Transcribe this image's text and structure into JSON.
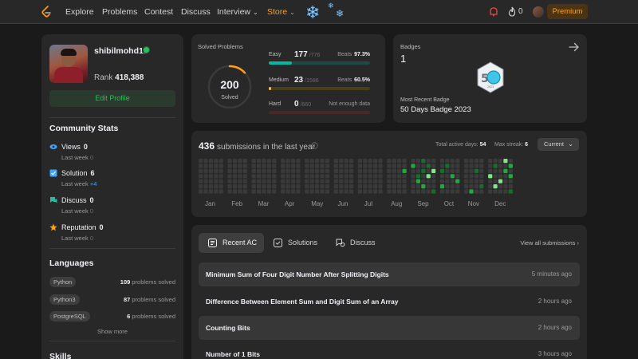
{
  "nav": {
    "links": [
      "Explore",
      "Problems",
      "Contest",
      "Discuss"
    ],
    "interview": "Interview",
    "store": "Store",
    "fire_count": "0",
    "premium": "Premium"
  },
  "profile": {
    "username": "shibilmohd13",
    "rank_label": "Rank",
    "rank_value": "418,388",
    "edit_button": "Edit Profile"
  },
  "community": {
    "title": "Community Stats",
    "stats": [
      {
        "label": "Views",
        "value": "0",
        "sub_label": "Last week",
        "sub_value": "0",
        "icon": "eye-icon"
      },
      {
        "label": "Solution",
        "value": "6",
        "sub_label": "Last week",
        "sub_value": "+4",
        "icon": "solution-icon"
      },
      {
        "label": "Discuss",
        "value": "0",
        "sub_label": "Last week",
        "sub_value": "0",
        "icon": "discuss-icon"
      },
      {
        "label": "Reputation",
        "value": "0",
        "sub_label": "Last week",
        "sub_value": "0",
        "icon": "star-icon"
      }
    ]
  },
  "languages": {
    "title": "Languages",
    "items": [
      {
        "name": "Python",
        "count": "109",
        "suffix": "problems solved"
      },
      {
        "name": "Python3",
        "count": "87",
        "suffix": "problems solved"
      },
      {
        "name": "PostgreSQL",
        "count": "6",
        "suffix": "problems solved"
      }
    ],
    "show_more": "Show more"
  },
  "skills": {
    "title": "Skills"
  },
  "solved": {
    "title": "Solved Problems",
    "total": "200",
    "total_label": "Solved",
    "easy": {
      "name": "Easy",
      "count": "177",
      "total": "/776",
      "beats_label": "Beats",
      "beats": "97.3%",
      "fraction": 0.228
    },
    "medium": {
      "name": "Medium",
      "count": "23",
      "total": "/1586",
      "beats_label": "Beats",
      "beats": "60.5%",
      "fraction": 0.0145
    },
    "hard": {
      "name": "Hard",
      "count": "0",
      "total": "/660",
      "beats": "Not enough data",
      "fraction": 0
    },
    "colors": {
      "easy": "#00b8a3",
      "medium": "#ffc01e",
      "hard": "#ef4743"
    }
  },
  "badges": {
    "label": "Badges",
    "count": "1",
    "recent_label": "Most Recent Badge",
    "recent_name": "50 Days Badge 2023"
  },
  "heatmap": {
    "count": "436",
    "title": "submissions in the last year",
    "active_days_label": "Total active days:",
    "active_days": "54",
    "max_streak_label": "Max streak:",
    "max_streak": "6",
    "period": "Current",
    "months": [
      "Jan",
      "Feb",
      "Mar",
      "Apr",
      "May",
      "Jun",
      "Jul",
      "Aug",
      "Sep",
      "Oct",
      "Nov",
      "Dec"
    ]
  },
  "tabs": {
    "items": [
      "Recent AC",
      "Solutions",
      "Discuss"
    ],
    "view_all": "View all submissions"
  },
  "recent": [
    {
      "title": "Minimum Sum of Four Digit Number After Splitting Digits",
      "time": "5 minutes ago"
    },
    {
      "title": "Difference Between Element Sum and Digit Sum of an Array",
      "time": "2 hours ago"
    },
    {
      "title": "Counting Bits",
      "time": "2 hours ago"
    },
    {
      "title": "Number of 1 Bits",
      "time": "3 hours ago"
    }
  ]
}
